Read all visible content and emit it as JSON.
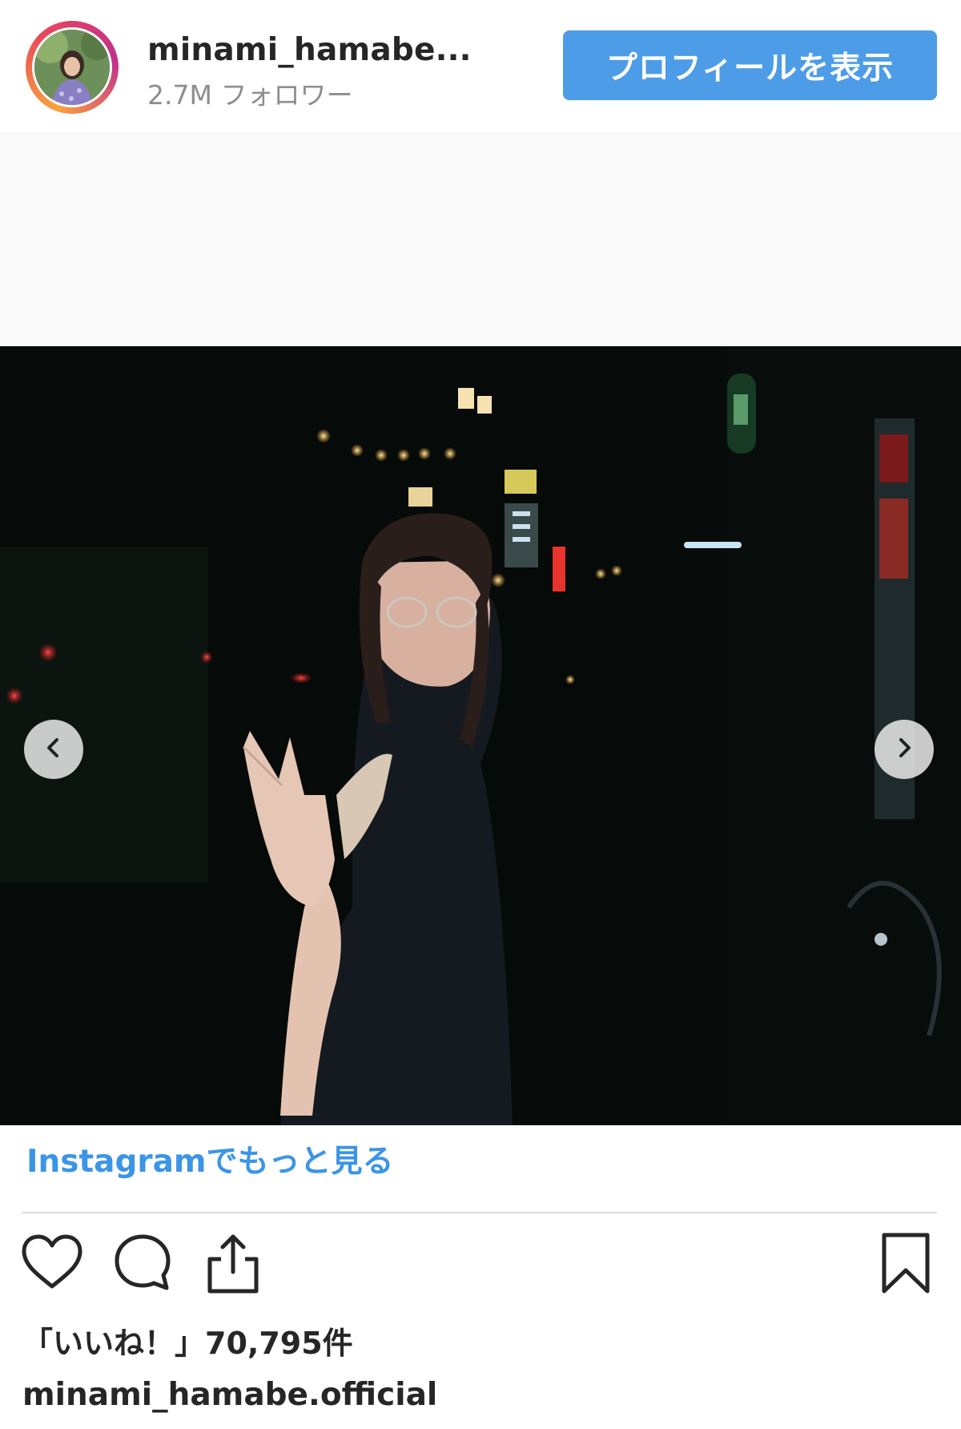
{
  "header": {
    "username": "minami_hamabe...",
    "followers": "2.7M フォロワー",
    "profile_button": "プロフィールを表示"
  },
  "post": {
    "carousel_prev_icon": "chevron-left-icon",
    "carousel_next_icon": "chevron-right-icon"
  },
  "more_link": "Instagramでもっと見る",
  "actions": {
    "like_icon": "heart-icon",
    "comment_icon": "comment-icon",
    "share_icon": "share-icon",
    "save_icon": "bookmark-icon"
  },
  "likes_text": "「いいね！」70,795件",
  "caption_username": "minami_hamabe.official",
  "colors": {
    "button_blue": "#4d9ce8",
    "link_blue": "#3b95e6",
    "text_dark": "#262626",
    "text_gray": "#8e8e8e"
  }
}
